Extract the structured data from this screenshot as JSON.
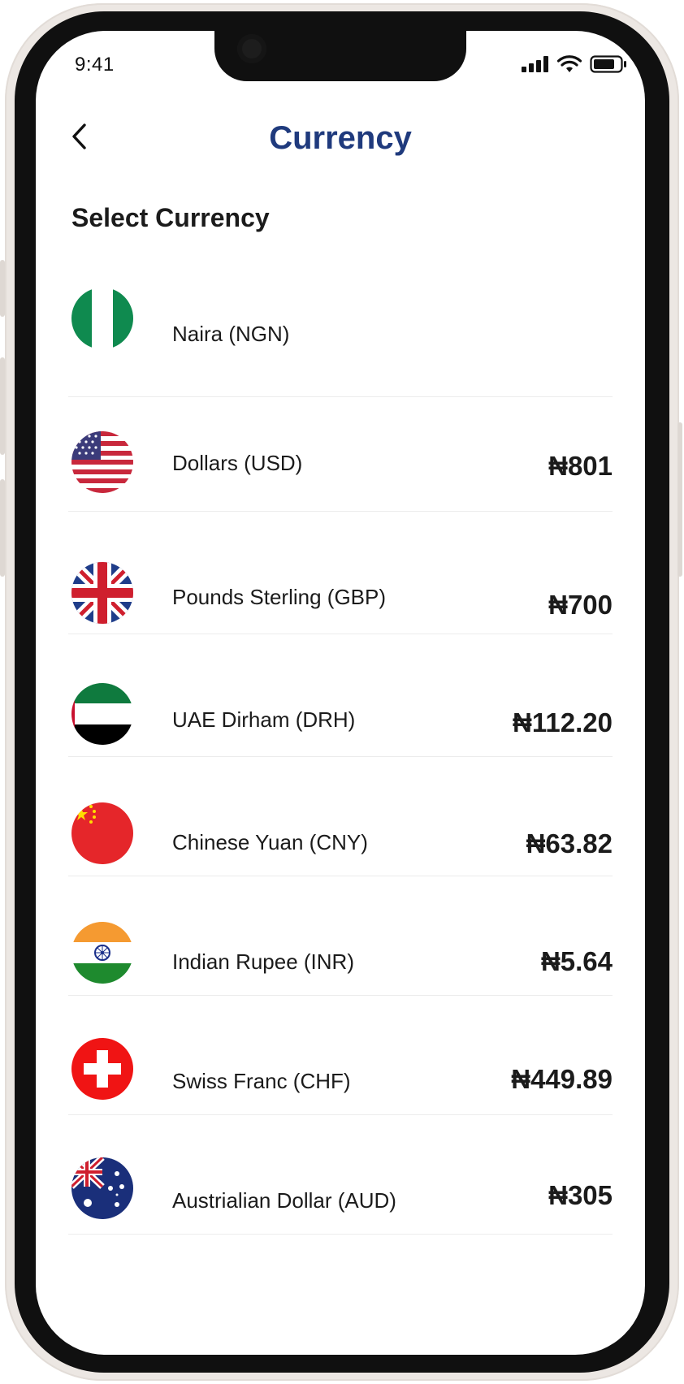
{
  "status_bar": {
    "time": "9:41"
  },
  "header": {
    "title": "Currency"
  },
  "section": {
    "title": "Select Currency"
  },
  "currency_symbol": "₦",
  "currencies": [
    {
      "name": "Naira (NGN)",
      "rate": "",
      "flag": "nigeria-flag-icon"
    },
    {
      "name": "Dollars (USD)",
      "rate": "₦801",
      "flag": "usa-flag-icon"
    },
    {
      "name": "Pounds Sterling (GBP)",
      "rate": "₦700",
      "flag": "uk-flag-icon"
    },
    {
      "name": "UAE Dirham (DRH)",
      "rate": "₦112.20",
      "flag": "uae-flag-icon"
    },
    {
      "name": "Chinese Yuan (CNY)",
      "rate": "₦63.82",
      "flag": "china-flag-icon"
    },
    {
      "name": "Indian Rupee (INR)",
      "rate": "₦5.64",
      "flag": "india-flag-icon"
    },
    {
      "name": "Swiss Franc (CHF)",
      "rate": "₦449.89",
      "flag": "switzerland-flag-icon"
    },
    {
      "name": "Austrialian Dollar (AUD)",
      "rate": "₦305",
      "flag": "australia-flag-icon"
    }
  ],
  "colors": {
    "title": "#1f3a7d",
    "text": "#1b1b1b",
    "divider": "#ececec"
  }
}
